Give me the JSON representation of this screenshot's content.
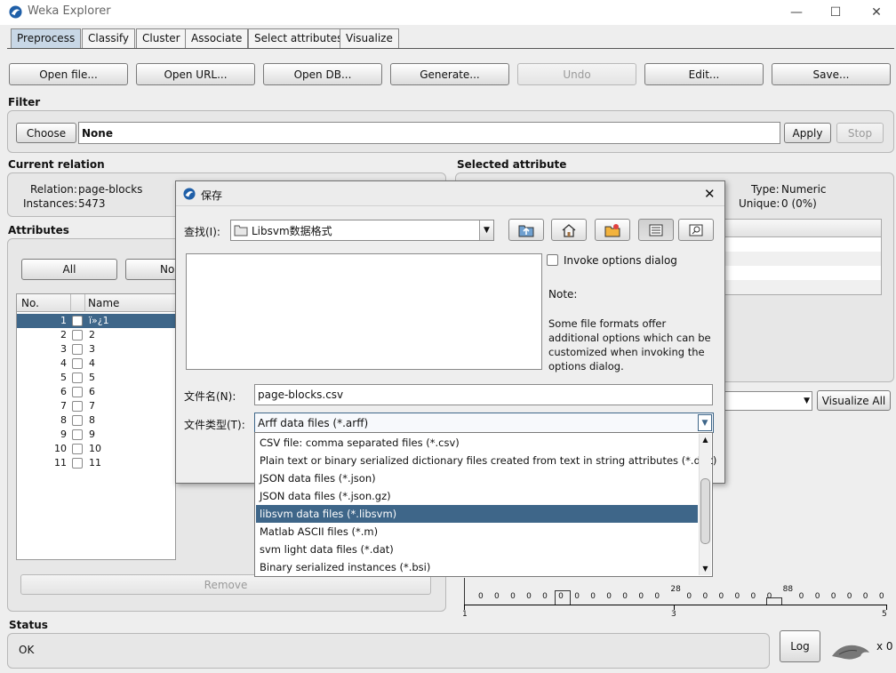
{
  "window": {
    "title": "Weka Explorer",
    "minimize": "—",
    "maximize": "☐",
    "close": "✕"
  },
  "tabs": [
    {
      "label": "Preprocess"
    },
    {
      "label": "Classify"
    },
    {
      "label": "Cluster"
    },
    {
      "label": "Associate"
    },
    {
      "label": "Select attributes"
    },
    {
      "label": "Visualize"
    }
  ],
  "toolbar": {
    "open_file": "Open file...",
    "open_url": "Open URL...",
    "open_db": "Open DB...",
    "generate": "Generate...",
    "undo": "Undo",
    "edit": "Edit...",
    "save": "Save..."
  },
  "filter": {
    "label": "Filter",
    "choose": "Choose",
    "value": "None",
    "apply": "Apply",
    "stop": "Stop"
  },
  "current_relation": {
    "label": "Current relation",
    "relation_label": "Relation:",
    "relation_value": "page-blocks",
    "instances_label": "Instances:",
    "instances_value": "5473"
  },
  "attributes": {
    "label": "Attributes",
    "all": "All",
    "none": "No",
    "col_no": "No.",
    "col_name": "Name",
    "rows": [
      {
        "no": "1",
        "name": "ï»¿1"
      },
      {
        "no": "2",
        "name": "2"
      },
      {
        "no": "3",
        "name": "3"
      },
      {
        "no": "4",
        "name": "4"
      },
      {
        "no": "5",
        "name": "5"
      },
      {
        "no": "6",
        "name": "6"
      },
      {
        "no": "7",
        "name": "7"
      },
      {
        "no": "8",
        "name": "8"
      },
      {
        "no": "9",
        "name": "9"
      },
      {
        "no": "10",
        "name": "10"
      },
      {
        "no": "11",
        "name": "11"
      }
    ],
    "remove": "Remove"
  },
  "selected_attribute": {
    "label": "Selected attribute",
    "type_label": "Type:",
    "type_value": "Numeric",
    "unique_label": "Unique:",
    "unique_value": "0 (0%)",
    "visualize_all": "Visualize All"
  },
  "histogram": {
    "values": [
      "0",
      "0",
      "0",
      "0",
      "0",
      "0",
      "0",
      "0",
      "0",
      "0",
      "0",
      "0",
      "28",
      "0",
      "0",
      "0",
      "0",
      "0",
      "0",
      "88",
      "0",
      "0",
      "0",
      "0",
      "0",
      "0"
    ],
    "axis": [
      "1",
      "3",
      "5"
    ]
  },
  "status": {
    "label": "Status",
    "text": "OK",
    "log": "Log",
    "count": "x 0"
  },
  "dialog": {
    "title": "保存",
    "look_in_label": "查找(I):",
    "look_in_value": "Libsvm数据格式",
    "invoke_options": "Invoke options dialog",
    "note_label": "Note:",
    "note_text": "Some file formats offer additional options which can be customized when invoking the options dialog.",
    "filename_label": "文件名(N):",
    "filename_value": "page-blocks.csv",
    "filetype_label": "文件类型(T):",
    "filetype_value": "Arff data files (*.arff)",
    "filetype_options": [
      "CSV file: comma separated files (*.csv)",
      "Plain text or binary serialized dictionary files created from text in string attributes (*.dict)",
      "JSON data files (*.json)",
      "JSON data files (*.json.gz)",
      "libsvm data files (*.libsvm)",
      "Matlab ASCII files (*.m)",
      "svm light data files (*.dat)",
      "Binary serialized instances (*.bsi)"
    ]
  }
}
